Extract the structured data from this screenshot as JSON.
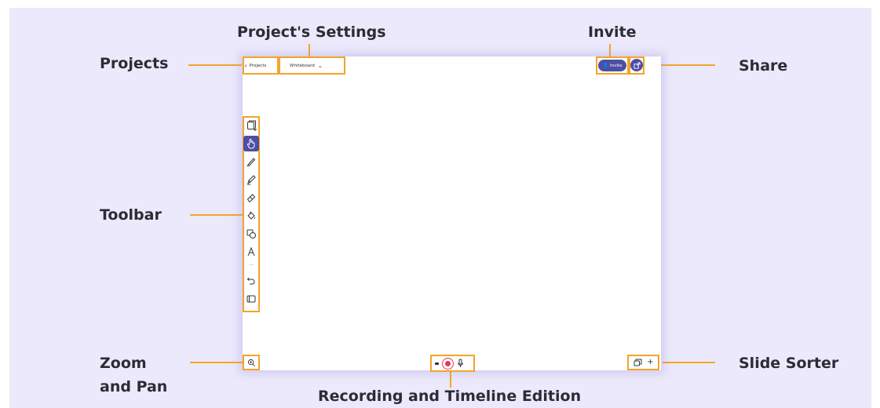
{
  "colors": {
    "highlight": "#f5a427",
    "accent": "#4c4fa3",
    "record": "#e8384f",
    "background": "#ebe9fb"
  },
  "callouts": {
    "projects": "Projects",
    "project_settings": "Project's Settings",
    "invite": "Invite",
    "share": "Share",
    "toolbar": "Toolbar",
    "zoom_line1": "Zoom",
    "zoom_line2": "and Pan",
    "slide_sorter": "Slide Sorter",
    "recording": "Recording and Timeline Edition"
  },
  "app": {
    "back_button_label": "Projects",
    "project_menu_label": "Whiteboard",
    "invite_button_label": "Invite"
  },
  "toolbar": {
    "tools": [
      {
        "name": "add-slide-icon",
        "active": false
      },
      {
        "name": "hand-icon",
        "active": true
      },
      {
        "name": "pen-icon",
        "active": false
      },
      {
        "name": "marker-icon",
        "active": false
      },
      {
        "name": "eraser-icon",
        "active": false
      },
      {
        "name": "fill-icon",
        "active": false
      },
      {
        "name": "shapes-icon",
        "active": false
      },
      {
        "name": "text-icon",
        "active": false
      },
      {
        "name": "undo-icon",
        "active": false
      },
      {
        "name": "frame-icon",
        "active": false
      }
    ]
  },
  "bottom": {
    "zoom_icon": "zoom-icon",
    "record_icon": "record-icon",
    "mic_icon": "microphone-icon",
    "slides_icon": "slides-icon",
    "add_slide_symbol": "+"
  }
}
